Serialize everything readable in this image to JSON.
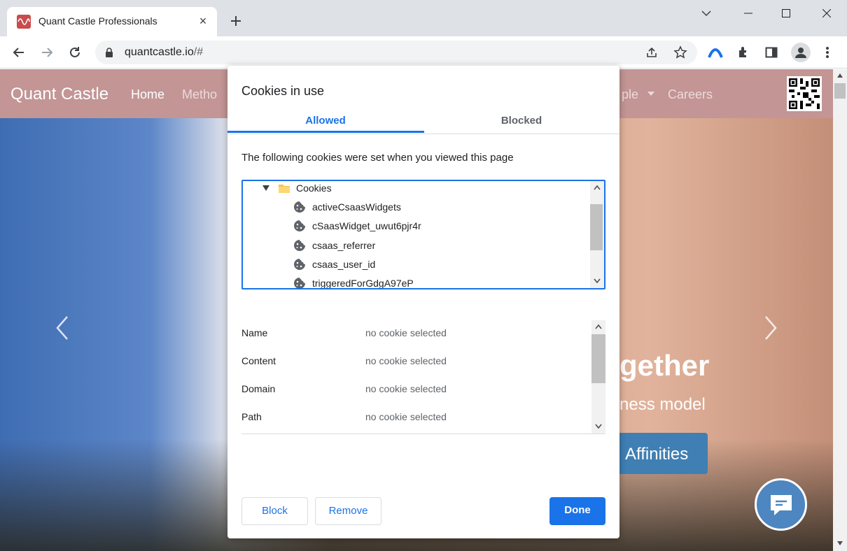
{
  "browser": {
    "tab_title": "Quant Castle Professionals",
    "close_glyph": "×",
    "url_host": "quantcastle.io",
    "url_path": "/#",
    "icons": [
      "favicon-icon",
      "close-icon",
      "new-tab-icon",
      "chevron-down-icon",
      "minimize-icon",
      "maximize-icon",
      "window-close-icon",
      "back-icon",
      "forward-icon",
      "reload-icon",
      "lock-icon",
      "share-icon",
      "star-icon",
      "extension-logo-icon",
      "puzzle-icon",
      "side-panel-icon",
      "profile-icon",
      "menu-icon"
    ]
  },
  "site": {
    "brand": "Quant Castle",
    "nav": {
      "home": "Home",
      "methodology": "Metho",
      "people": "ple",
      "careers": "Careers"
    },
    "hero": {
      "title": "gether",
      "subtitle": "ness model",
      "button": "Affinities"
    }
  },
  "dialog": {
    "title": "Cookies in use",
    "tabs": {
      "allowed": "Allowed",
      "blocked": "Blocked"
    },
    "intro": "The following cookies were set when you viewed this page",
    "tree": {
      "folder": "Cookies",
      "cookies": [
        "activeCsaasWidgets",
        "cSaasWidget_uwut6pjr4r",
        "csaas_referrer",
        "csaas_user_id",
        "triggeredForGdgA97eP"
      ]
    },
    "details": [
      {
        "label": "Name",
        "value": "no cookie selected"
      },
      {
        "label": "Content",
        "value": "no cookie selected"
      },
      {
        "label": "Domain",
        "value": "no cookie selected"
      },
      {
        "label": "Path",
        "value": "no cookie selected"
      }
    ],
    "buttons": {
      "block": "Block",
      "remove": "Remove",
      "done": "Done"
    }
  },
  "colors": {
    "accent": "#1a73e8",
    "navbar": "#c39595",
    "hero_button": "#3f7fb3",
    "chat": "#4d86c0"
  }
}
